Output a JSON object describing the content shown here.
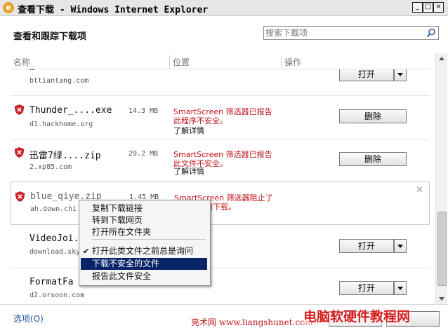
{
  "window": {
    "title": "查看下载 - Windows Internet Explorer",
    "app_icon": "ie-icon",
    "buttons": {
      "minimize": "_",
      "maximize": "□",
      "close": "×"
    }
  },
  "header": {
    "title": "查看和跟踪下载项",
    "search_placeholder": "搜索下载项",
    "search_icon": "search-icon"
  },
  "columns": {
    "name": "名称",
    "location": "位置",
    "actions": "操作"
  },
  "downloads": [
    {
      "name": "…",
      "size": "",
      "host": "bttiantang.com",
      "warning": "",
      "more": "",
      "action": "打开"
    },
    {
      "name": "Thunder_....exe",
      "size": "14.3 MB",
      "host": "d1.hackhome.org",
      "warning": "SmartScreen 筛选器已报告此程序不安全。",
      "more": "了解详情",
      "action": "删除"
    },
    {
      "name": "迅雷7绿....zip",
      "size": "29.2 MB",
      "host": "2.xp85.com",
      "warning": "SmartScreen 筛选器已报告此文件不安全。",
      "more": "了解详情",
      "action": "删除"
    },
    {
      "name": "blue_qiye.zip",
      "size": "1.45 MB",
      "host": "ah.down.chi",
      "warning": "SmartScreen 筛选器阻止了此不安全的下载。",
      "more": "",
      "action": ""
    },
    {
      "name": "VideoJoi.",
      "size": "",
      "host": "download.sky",
      "warning": "",
      "more": "",
      "action": "打开"
    },
    {
      "name": "FormatFa",
      "size": "",
      "host": "d2.orsoon.com",
      "warning": "",
      "more": "",
      "action": "打开"
    }
  ],
  "context_menu": {
    "items": [
      {
        "label": "复制下载链接",
        "checked": false,
        "highlighted": false
      },
      {
        "label": "转到下载网页",
        "checked": false,
        "highlighted": false
      },
      {
        "label": "打开所在文件夹",
        "checked": false,
        "highlighted": false
      },
      {
        "label": "打开此类文件之前总是询问",
        "checked": true,
        "highlighted": false
      },
      {
        "label": "下载不安全的文件",
        "checked": false,
        "highlighted": true
      },
      {
        "label": "报告此文件安全",
        "checked": false,
        "highlighted": false
      }
    ],
    "check_mark": "✔"
  },
  "footer": {
    "options_link": "选项(O)"
  },
  "watermark": {
    "site_text": "亮术网 www.liangshunet.com",
    "brand_text": "电脑软硬件教程网"
  },
  "colors": {
    "warning_red": "#c0151a",
    "link_blue": "#1a4f9c",
    "menu_highlight": "#0a246a"
  }
}
